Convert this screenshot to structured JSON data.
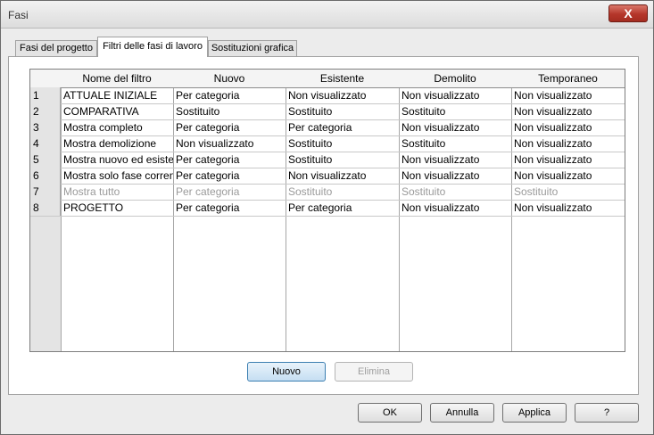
{
  "window": {
    "title": "Fasi",
    "close_label": "X"
  },
  "tabs": [
    {
      "label": "Fasi del progetto"
    },
    {
      "label": "Filtri delle fasi di lavoro"
    },
    {
      "label": "Sostituzioni grafica"
    }
  ],
  "table": {
    "columns": [
      "Nome del filtro",
      "Nuovo",
      "Esistente",
      "Demolito",
      "Temporaneo"
    ],
    "rows": [
      {
        "num": "1",
        "name": "ATTUALE INIZIALE",
        "nuovo": "Per categoria",
        "esistente": "Non visualizzato",
        "demolito": "Non visualizzato",
        "temporaneo": "Non visualizzato"
      },
      {
        "num": "2",
        "name": "COMPARATIVA",
        "nuovo": "Sostituito",
        "esistente": "Sostituito",
        "demolito": "Sostituito",
        "temporaneo": "Non visualizzato"
      },
      {
        "num": "3",
        "name": "Mostra completo",
        "nuovo": "Per categoria",
        "esistente": "Per categoria",
        "demolito": "Non visualizzato",
        "temporaneo": "Non visualizzato"
      },
      {
        "num": "4",
        "name": "Mostra demolizione",
        "nuovo": "Non visualizzato",
        "esistente": "Sostituito",
        "demolito": "Sostituito",
        "temporaneo": "Non visualizzato"
      },
      {
        "num": "5",
        "name": "Mostra nuovo ed esiste",
        "nuovo": "Per categoria",
        "esistente": "Sostituito",
        "demolito": "Non visualizzato",
        "temporaneo": "Non visualizzato"
      },
      {
        "num": "6",
        "name": "Mostra solo fase corren",
        "nuovo": "Per categoria",
        "esistente": "Non visualizzato",
        "demolito": "Non visualizzato",
        "temporaneo": "Non visualizzato"
      },
      {
        "num": "7",
        "name": "Mostra tutto",
        "nuovo": "Per categoria",
        "esistente": "Sostituito",
        "demolito": "Sostituito",
        "temporaneo": "Sostituito"
      },
      {
        "num": "8",
        "name": "PROGETTO",
        "nuovo": "Per categoria",
        "esistente": "Per categoria",
        "demolito": "Non visualizzato",
        "temporaneo": "Non visualizzato"
      }
    ]
  },
  "panel_buttons": {
    "new_label": "Nuovo",
    "delete_label": "Elimina"
  },
  "dialog_buttons": {
    "ok_label": "OK",
    "cancel_label": "Annulla",
    "apply_label": "Applica",
    "help_label": "?"
  }
}
